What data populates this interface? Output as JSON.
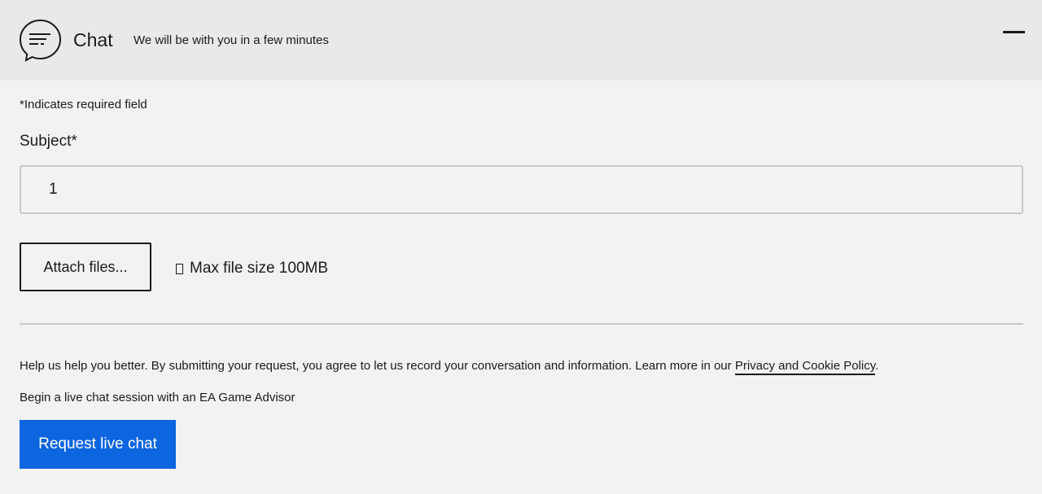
{
  "header": {
    "title": "Chat",
    "subtitle": "We will be with you in a few minutes",
    "icon": "chat-bubble-icon",
    "minimize_icon": "minimize-icon"
  },
  "form": {
    "required_note": "*Indicates required field",
    "subject_label": "Subject*",
    "subject_value": "1",
    "attach_label": "Attach files...",
    "info_icon": "info-icon",
    "file_size_note": "Max file size 100MB"
  },
  "footer": {
    "consent_text": "Help us help you better. By submitting your request, you agree to let us record your conversation and information. Learn more in our ",
    "policy_link": "Privacy and Cookie Policy",
    "consent_end": ".",
    "session_note": "Begin a live chat session with an EA Game Advisor",
    "request_label": "Request live chat"
  },
  "colors": {
    "header_bg": "#e9e9e9",
    "page_bg": "#f2f2f2",
    "accent": "#0d65e0"
  }
}
